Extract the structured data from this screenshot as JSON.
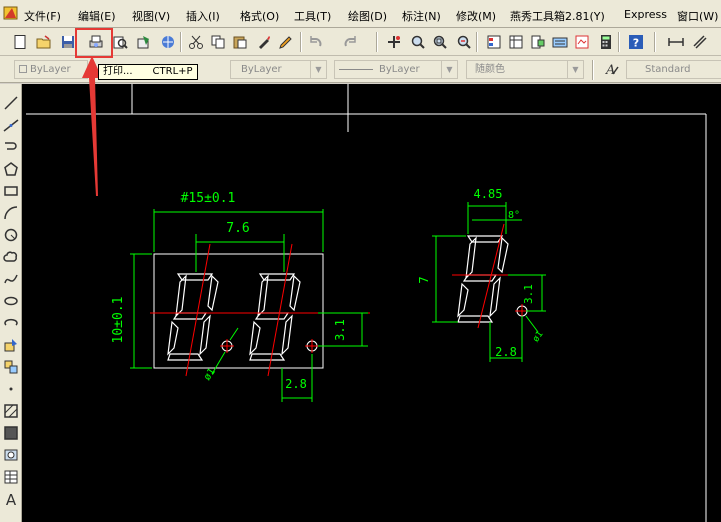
{
  "menu": {
    "items": [
      {
        "label": "文件(F)"
      },
      {
        "label": "编辑(E)"
      },
      {
        "label": "视图(V)"
      },
      {
        "label": "插入(I)"
      },
      {
        "label": "格式(O)"
      },
      {
        "label": "工具(T)"
      },
      {
        "label": "绘图(D)"
      },
      {
        "label": "标注(N)"
      },
      {
        "label": "修改(M)"
      },
      {
        "label": "燕秀工具箱2.81(Y)"
      },
      {
        "label": "Express"
      },
      {
        "label": "窗口(W)"
      }
    ]
  },
  "properties_bar": {
    "layer_combo": "ByLayer",
    "linetype_combo": "ByLayer",
    "lineweight_combo": "ByLayer",
    "color_combo": "随颜色",
    "text_style_combo": "Standard"
  },
  "tooltip": {
    "label": "打印...",
    "shortcut": "CTRL+P"
  },
  "drawing": {
    "dim_width_total": "#15±0.1",
    "dim_digit_pitch": "7.6",
    "dim_height_total": "10±0.1",
    "dim_segment_height_right": "3.1",
    "dim_dp_offset": "2.8",
    "dim_dp_diameter": "ø1",
    "dim_single_width": "4.85",
    "dim_single_slant": "8°",
    "dim_single_height": "7",
    "dim_single_seg": "3.1",
    "dim_single_dp_offset": "2.8",
    "dim_single_dp_dia": "ø1"
  },
  "colors": {
    "canvas": "#000000",
    "dimension": "#00ff00",
    "outline": "#ffffff",
    "centerline": "#ff0000",
    "highlight": "#e53935",
    "chrome": "#ece9d8"
  }
}
